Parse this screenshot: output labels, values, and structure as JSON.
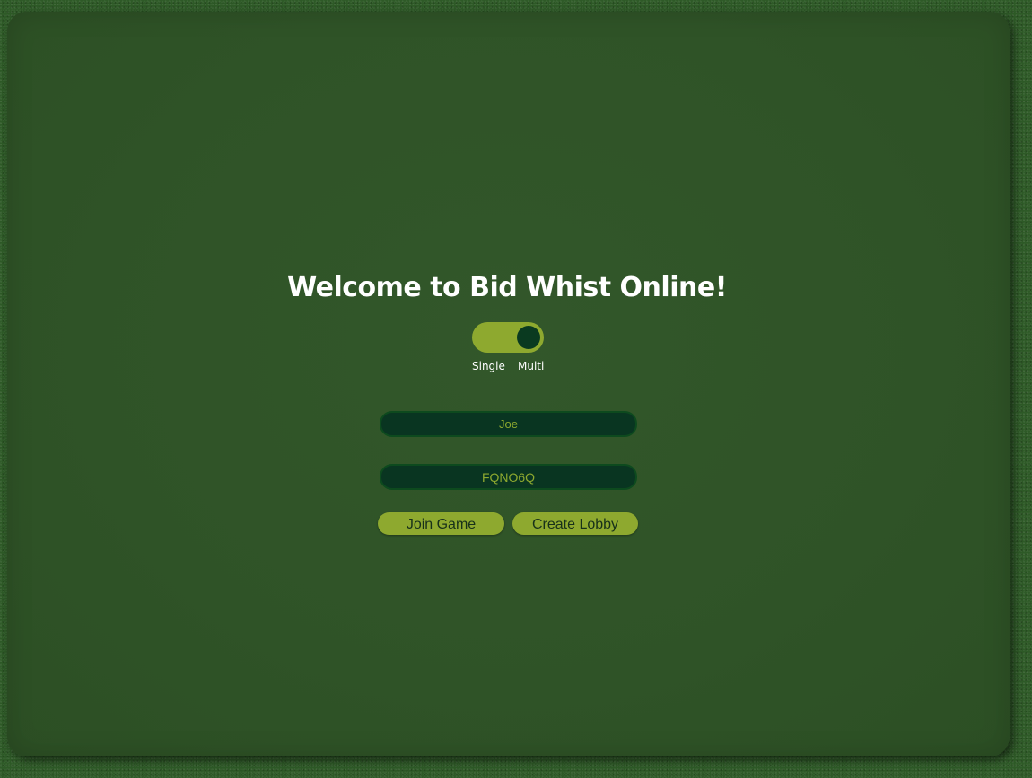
{
  "title": "Welcome to Bid Whist Online!",
  "mode_toggle": {
    "left_label": "Single",
    "right_label": "Multi",
    "selected": "Multi"
  },
  "form": {
    "name_value": "Joe",
    "lobby_code_value": "FQNO6Q"
  },
  "buttons": {
    "join": "Join Game",
    "create": "Create Lobby"
  },
  "colors": {
    "felt": "#2f5327",
    "accent": "#8ea92f",
    "field_bg": "#093521",
    "knob": "#0a3a20"
  }
}
